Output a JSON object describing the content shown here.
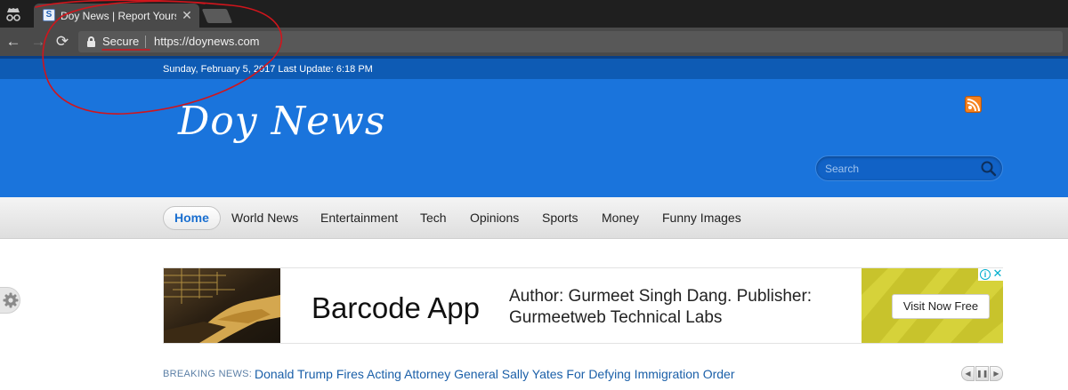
{
  "browser": {
    "tab_title": "Doy News | Report Yourself",
    "tab_close": "✕",
    "favicon_letter": "S",
    "secure_label": "Secure",
    "url": "https://doynews.com",
    "back_glyph": "←",
    "forward_glyph": "→",
    "reload_glyph": "⟳",
    "incognito_icon": "incognito-icon"
  },
  "site": {
    "date_line": "Sunday, February 5, 2017 Last Update: 6:18 PM",
    "logo": "Doy News",
    "search_placeholder": "Search",
    "colors": {
      "header_blue": "#1a74dc",
      "date_bar_blue": "#0e5bb4",
      "active_menu_text": "#1a6fd0",
      "rss_orange": "#f5821f",
      "annotation_red": "#d0151c"
    }
  },
  "nav": {
    "items": [
      {
        "label": "Home",
        "active": true
      },
      {
        "label": "World News"
      },
      {
        "label": "Entertainment"
      },
      {
        "label": "Tech"
      },
      {
        "label": "Opinions"
      },
      {
        "label": "Sports"
      },
      {
        "label": "Money"
      },
      {
        "label": "Funny Images"
      }
    ]
  },
  "ad": {
    "title": "Barcode App",
    "description": "Author: Gurmeet Singh Dang. Publisher: Gurmeetweb Technical Labs",
    "cta": "Visit Now Free",
    "adchoices_info": "i",
    "adchoices_close": "✕"
  },
  "breaking": {
    "label": "BREAKING NEWS:",
    "headline": "Donald Trump Fires Acting Attorney General Sally Yates For Defying Immigration Order",
    "prev": "◀",
    "pause": "❚❚",
    "next": "▶"
  }
}
